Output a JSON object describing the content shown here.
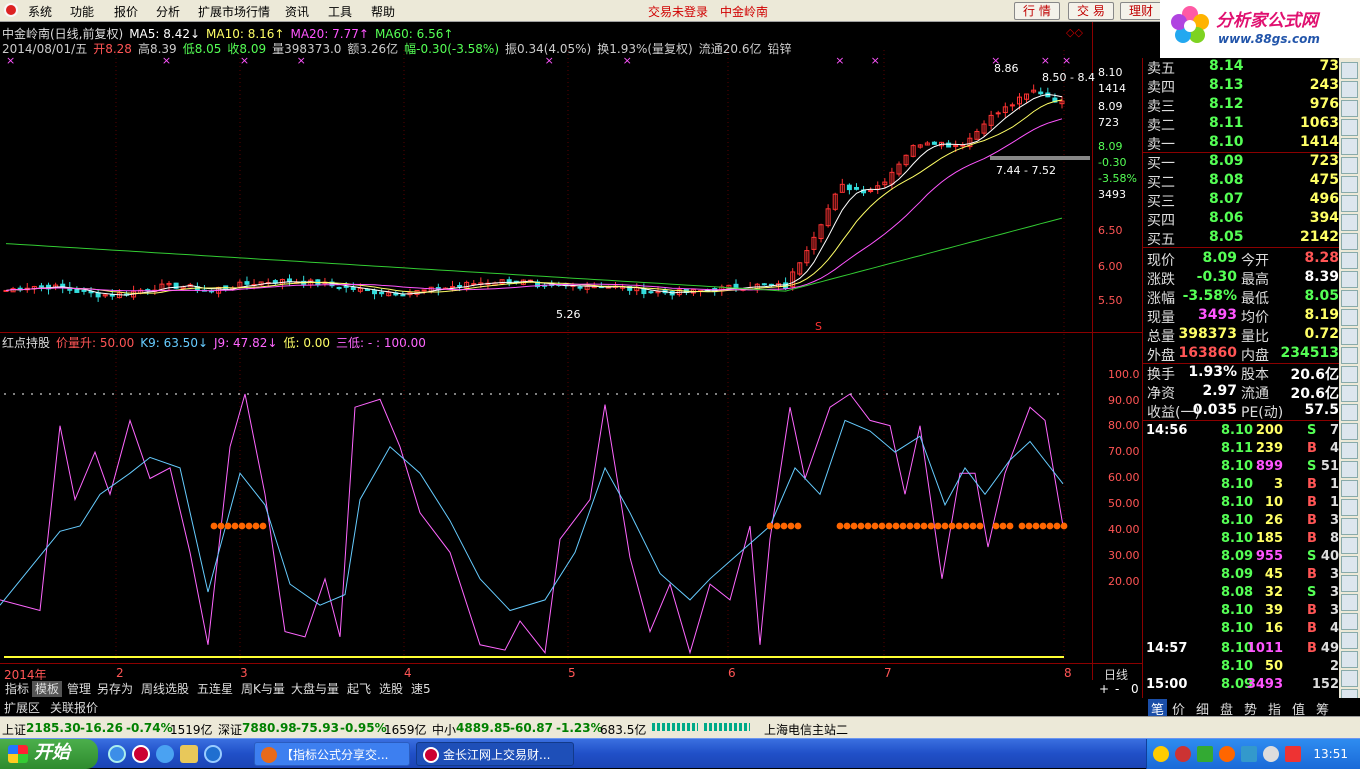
{
  "menu": {
    "items": [
      "系统",
      "功能",
      "报价",
      "分析",
      "扩展市场行情",
      "资讯",
      "工具",
      "帮助"
    ],
    "status": "交易未登录",
    "stock": "中金岭南",
    "buttons": [
      "行 情",
      "交 易",
      "理财"
    ]
  },
  "brand": {
    "title": "分析家公式网",
    "url": "www.88gs.com"
  },
  "header": {
    "line1": [
      {
        "t": "中金岭南(日线,前复权)",
        "c": "#dddddd"
      },
      {
        "t": "MA5: 8.42↓",
        "c": "#ffffff"
      },
      {
        "t": "MA10: 8.16↑",
        "c": "#ffff66"
      },
      {
        "t": "MA20: 7.77↑",
        "c": "#ff55ff"
      },
      {
        "t": "MA60: 6.56↑",
        "c": "#55ff55"
      }
    ],
    "line2": [
      {
        "t": "2014/08/01/五",
        "c": "#cccccc"
      },
      {
        "t": "开8.28",
        "c": "#ff5555"
      },
      {
        "t": "高8.39",
        "c": "#cccccc"
      },
      {
        "t": "低8.05",
        "c": "#55ff55"
      },
      {
        "t": "收8.09",
        "c": "#55ff55"
      },
      {
        "t": "量398373.0",
        "c": "#cccccc"
      },
      {
        "t": "额3.26亿",
        "c": "#cccccc"
      },
      {
        "t": "幅-0.30(-3.58%)",
        "c": "#55ff55"
      },
      {
        "t": "振0.34(4.05%)",
        "c": "#cccccc"
      },
      {
        "t": "换1.93%(量复权)",
        "c": "#cccccc"
      },
      {
        "t": "流通20.6亿",
        "c": "#cccccc"
      },
      {
        "t": "铅锌",
        "c": "#cccccc"
      }
    ]
  },
  "price_axis": [
    "8.10",
    "1414",
    "8.09",
    "723",
    "8.09",
    "-0.30",
    "-3.58%",
    "3493",
    "6.50",
    "6.00",
    "5.50"
  ],
  "price_annotations": {
    "high": "8.86",
    "hl": "8.50 - 8.4",
    "mid": "7.44 - 7.52",
    "low": "5.26",
    "signal": "S"
  },
  "indicator": {
    "items": [
      {
        "t": "红点持股",
        "c": "#dddddd"
      },
      {
        "t": "价量升: 50.00",
        "c": "#ff5555"
      },
      {
        "t": "K9: 63.50↓",
        "c": "#66ccff"
      },
      {
        "t": "J9: 47.82↓",
        "c": "#ff66ff"
      },
      {
        "t": "低: 0.00",
        "c": "#ffff66"
      },
      {
        "t": "三低: - : 100.00",
        "c": "#ff66ff"
      }
    ],
    "axis": [
      "100.0",
      "90.00",
      "80.00",
      "70.00",
      "60.00",
      "50.00",
      "40.00",
      "30.00",
      "20.00"
    ]
  },
  "timeline": {
    "labels": [
      "2014年",
      "2",
      "3",
      "4",
      "5",
      "6",
      "7",
      "8"
    ],
    "right": "日线"
  },
  "tabs": [
    "指标",
    "模板",
    "管理",
    "另存为",
    "周线选股",
    "五连星",
    "周K与量",
    "大盘与量",
    "起飞",
    "选股",
    "速5"
  ],
  "tabs2": [
    "扩展区",
    "关联报价"
  ],
  "tab_controls": [
    "+",
    "-",
    "0"
  ],
  "orderbook": {
    "asks": [
      {
        "label": "卖五",
        "price": "8.14",
        "vol": "73"
      },
      {
        "label": "卖四",
        "price": "8.13",
        "vol": "243"
      },
      {
        "label": "卖三",
        "price": "8.12",
        "vol": "976"
      },
      {
        "label": "卖二",
        "price": "8.11",
        "vol": "1063"
      },
      {
        "label": "卖一",
        "price": "8.10",
        "vol": "1414"
      }
    ],
    "bids": [
      {
        "label": "买一",
        "price": "8.09",
        "vol": "723"
      },
      {
        "label": "买二",
        "price": "8.08",
        "vol": "475"
      },
      {
        "label": "买三",
        "price": "8.07",
        "vol": "496"
      },
      {
        "label": "买四",
        "price": "8.06",
        "vol": "394"
      },
      {
        "label": "买五",
        "price": "8.05",
        "vol": "2142"
      }
    ]
  },
  "quote": [
    {
      "l1": "现价",
      "v1": "8.09",
      "c1": "#55ff55",
      "l2": "今开",
      "v2": "8.28",
      "c2": "#ff5555"
    },
    {
      "l1": "涨跌",
      "v1": "-0.30",
      "c1": "#55ff55",
      "l2": "最高",
      "v2": "8.39",
      "c2": "#ffffff"
    },
    {
      "l1": "涨幅",
      "v1": "-3.58%",
      "c1": "#55ff55",
      "l2": "最低",
      "v2": "8.05",
      "c2": "#55ff55"
    },
    {
      "l1": "现量",
      "v1": "3493",
      "c1": "#ff55ff",
      "l2": "均价",
      "v2": "8.19",
      "c2": "#ffff66"
    },
    {
      "l1": "总量",
      "v1": "398373",
      "c1": "#ffff66",
      "l2": "量比",
      "v2": "0.72",
      "c2": "#ffff66"
    },
    {
      "l1": "外盘",
      "v1": "163860",
      "c1": "#ff5555",
      "l2": "内盘",
      "v2": "234513",
      "c2": "#55ff55"
    },
    {
      "l1": "换手",
      "v1": "1.93%",
      "c1": "#ffffff",
      "l2": "股本",
      "v2": "20.6亿",
      "c2": "#ffffff"
    },
    {
      "l1": "净资",
      "v1": "2.97",
      "c1": "#ffffff",
      "l2": "流通",
      "v2": "20.6亿",
      "c2": "#ffffff"
    },
    {
      "l1": "收益(一)",
      "v1": "0.035",
      "c1": "#ffffff",
      "l2": "PE(动)",
      "v2": "57.5",
      "c2": "#ffffff"
    }
  ],
  "ticks": [
    {
      "time": "14:56",
      "price": "8.10",
      "vol": "200",
      "bs": "S",
      "n": "7",
      "vc": "#ffff66"
    },
    {
      "time": "",
      "price": "8.11",
      "vol": "239",
      "bs": "B",
      "n": "4",
      "vc": "#ffff66"
    },
    {
      "time": "",
      "price": "8.10",
      "vol": "899",
      "bs": "S",
      "n": "51",
      "vc": "#ff55ff"
    },
    {
      "time": "",
      "price": "8.10",
      "vol": "3",
      "bs": "B",
      "n": "1",
      "vc": "#ffff66"
    },
    {
      "time": "",
      "price": "8.10",
      "vol": "10",
      "bs": "B",
      "n": "1",
      "vc": "#ffff66"
    },
    {
      "time": "",
      "price": "8.10",
      "vol": "26",
      "bs": "B",
      "n": "3",
      "vc": "#ffff66"
    },
    {
      "time": "",
      "price": "8.10",
      "vol": "185",
      "bs": "B",
      "n": "8",
      "vc": "#ffff66"
    },
    {
      "time": "",
      "price": "8.09",
      "vol": "955",
      "bs": "S",
      "n": "40",
      "vc": "#ff55ff"
    },
    {
      "time": "",
      "price": "8.09",
      "vol": "45",
      "bs": "B",
      "n": "3",
      "vc": "#ffff66"
    },
    {
      "time": "",
      "price": "8.08",
      "vol": "32",
      "bs": "S",
      "n": "3",
      "vc": "#ffff66"
    },
    {
      "time": "",
      "price": "8.10",
      "vol": "39",
      "bs": "B",
      "n": "3",
      "vc": "#ffff66"
    },
    {
      "time": "",
      "price": "8.10",
      "vol": "16",
      "bs": "B",
      "n": "4",
      "vc": "#ffff66"
    },
    {
      "time": "14:57",
      "price": "8.10",
      "vol": "1011",
      "bs": "B",
      "n": "49",
      "vc": "#ff55ff"
    },
    {
      "time": "",
      "price": "8.10",
      "vol": "50",
      "bs": "",
      "n": "2",
      "vc": "#ffff66"
    },
    {
      "time": "15:00",
      "price": "8.09",
      "vol": "3493",
      "bs": "",
      "n": "152",
      "vc": "#ff55ff"
    }
  ],
  "rtabs": [
    "笔",
    "价",
    "细",
    "盘",
    "势",
    "指",
    "值",
    "筹"
  ],
  "statusbar": {
    "items": [
      {
        "t": "上证",
        "c": "#000000"
      },
      {
        "t": "2185.30",
        "c": "#008000"
      },
      {
        "t": "-16.26",
        "c": "#008000"
      },
      {
        "t": "-0.74%",
        "c": "#008000"
      },
      {
        "t": "1519亿",
        "c": "#000000"
      },
      {
        "t": "深证",
        "c": "#000000"
      },
      {
        "t": "7880.98",
        "c": "#008000"
      },
      {
        "t": "-75.93",
        "c": "#008000"
      },
      {
        "t": "-0.95%",
        "c": "#008000"
      },
      {
        "t": "1659亿",
        "c": "#000000"
      },
      {
        "t": "中小",
        "c": "#000000"
      },
      {
        "t": "4889.85",
        "c": "#008000"
      },
      {
        "t": "-60.87",
        "c": "#008000"
      },
      {
        "t": "-1.23%",
        "c": "#008000"
      },
      {
        "t": "683.5亿",
        "c": "#000000"
      },
      {
        "t": "上海电信主站二",
        "c": "#000000"
      }
    ]
  },
  "taskbar": {
    "start": "开始",
    "tasks": [
      "【指标公式分享交...",
      "金长江网上交易财..."
    ],
    "clock": "13:51"
  },
  "colors": {
    "up": "#ff3333",
    "down": "#33dddd",
    "ma5": "#ffffff",
    "ma10": "#ffff66",
    "ma20": "#ff55ff",
    "ma60": "#33cc33",
    "k": "#66ccff",
    "j": "#ff66ff",
    "signal": "#ff6600",
    "low": "#ffff33"
  }
}
